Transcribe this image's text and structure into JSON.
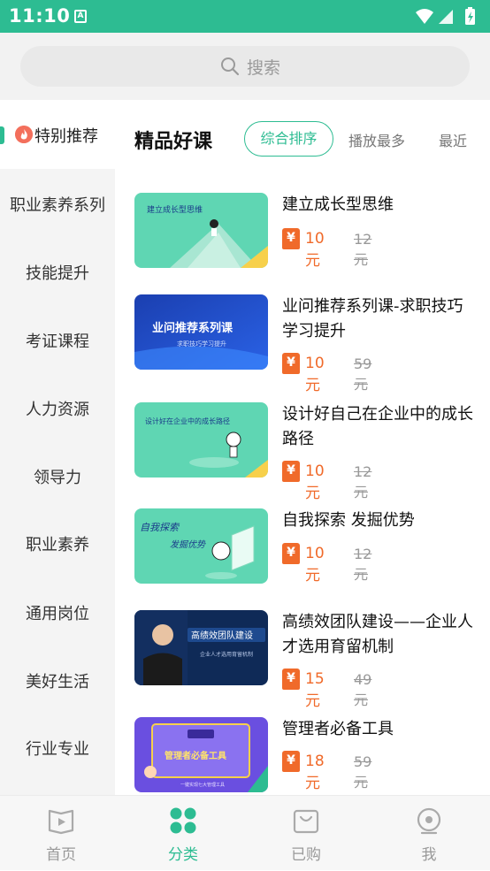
{
  "status_bar": {
    "time": "11:10",
    "notification": "A"
  },
  "search": {
    "placeholder": "搜索"
  },
  "sidebar": {
    "active": "特别推荐",
    "items": [
      "职业素养系列",
      "技能提升",
      "考证课程",
      "人力资源",
      "领导力",
      "职业素养",
      "通用岗位",
      "美好生活",
      "行业专业"
    ]
  },
  "content": {
    "heading": "精品好课",
    "sort": {
      "active": "综合排序",
      "options": [
        "播放最多",
        "最近"
      ]
    }
  },
  "courses": [
    {
      "title": "建立成长型思维",
      "price": "10元",
      "original": "12元",
      "thumb_text": "建立成长型思维"
    },
    {
      "title": "业问推荐系列课-求职技巧学习提升",
      "price": "10元",
      "original": "59元",
      "thumb_text": "业问推荐系列课",
      "thumb_sub": "求职技巧学习提升"
    },
    {
      "title": "设计好自己在企业中的成长路径",
      "price": "10元",
      "original": "12元",
      "thumb_text": "设计好在企业中的成长路径"
    },
    {
      "title": "自我探索 发掘优势",
      "price": "10元",
      "original": "12元",
      "thumb_text": "自我探索",
      "thumb_sub": "发掘优势"
    },
    {
      "title": "高绩效团队建设——企业人才选用育留机制",
      "price": "15元",
      "original": "49元",
      "thumb_text": "高绩效团队建设",
      "thumb_sub": "企业人才选用育留机制"
    },
    {
      "title": "管理者必备工具",
      "price": "18元",
      "original": "59元",
      "thumb_text": "管理者必备工具",
      "thumb_sub": "一键实现七大管理工具"
    }
  ],
  "tabs": [
    "首页",
    "分类",
    "已购",
    "我"
  ],
  "colors": {
    "accent": "#2dbc92",
    "price": "#f06a2a"
  }
}
